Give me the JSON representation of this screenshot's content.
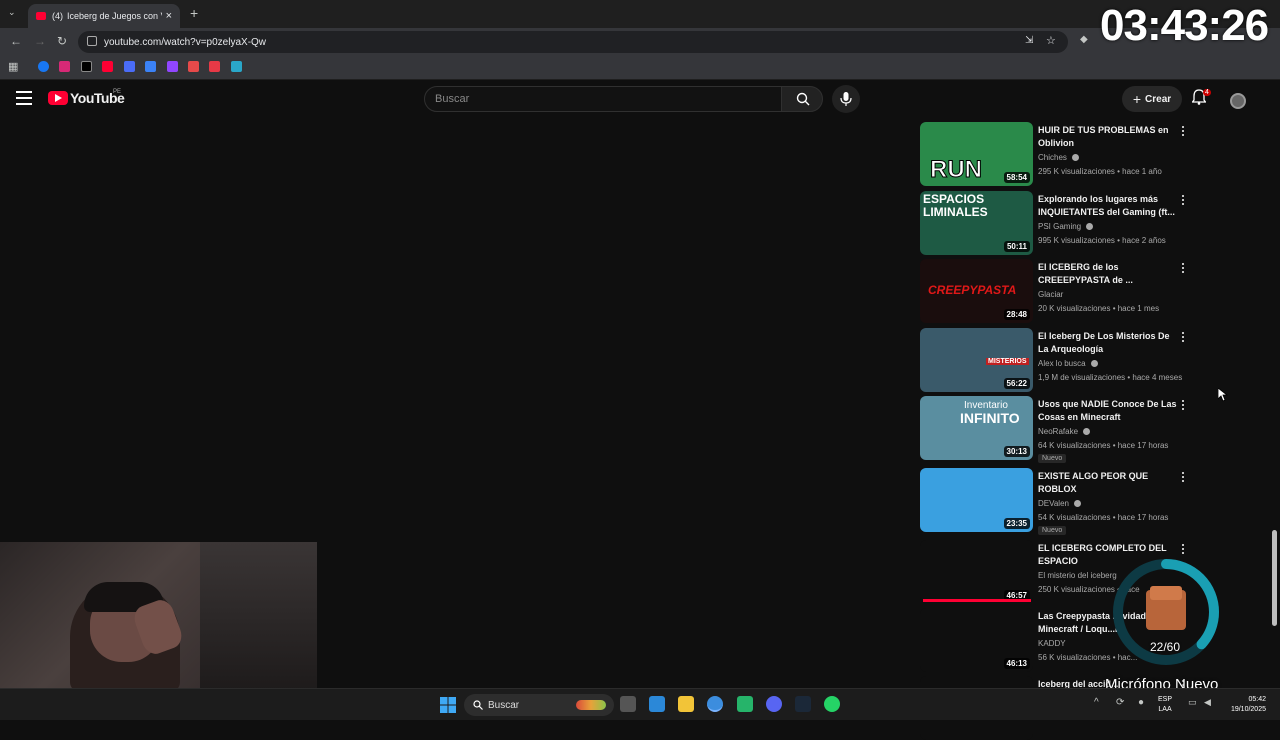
{
  "browser": {
    "tab_title": "Iceberg de Juegos con V",
    "tab_count_badge": "(4)",
    "url": "youtube.com/watch?v=p0zelyaX-Qw"
  },
  "overlay": {
    "timer": "03:43:26",
    "mic_count": "22/60",
    "mic_label": "Micrófono Nuevo"
  },
  "youtube": {
    "logo_text": "YouTube",
    "country": "PE",
    "search_placeholder": "Buscar",
    "create_label": "Crear",
    "notif_count": "4"
  },
  "videos": [
    {
      "title": "HUIR DE TUS PROBLEMAS en Oblivion",
      "channel": "Chiches",
      "verified": true,
      "meta": "295 K visualizaciones • hace 1 año",
      "duration": "58:54",
      "badge": "",
      "thumb_color": "#2a8a4a"
    },
    {
      "title": "Explorando los lugares más INQUIETANTES del Gaming (ft...",
      "channel": "PSI Gaming",
      "verified": true,
      "meta": "995 K visualizaciones • hace 2 años",
      "duration": "50:11",
      "badge": "",
      "thumb_color": "#1e5a44"
    },
    {
      "title": "El ICEBERG de los CREEEPYPASTA de ...",
      "channel": "Glaciar",
      "verified": false,
      "meta": "20 K visualizaciones • hace 1 mes",
      "duration": "28:48",
      "badge": "",
      "thumb_color": "#1a0d0d"
    },
    {
      "title": "El Iceberg De Los Misterios De La Arqueología",
      "channel": "Alex lo busca",
      "verified": true,
      "meta": "1,9 M de visualizaciones • hace 4 meses",
      "duration": "56:22",
      "badge": "",
      "thumb_color": "#3a5a6a"
    },
    {
      "title": "Usos que NADIE Conoce De Las Cosas en Minecraft",
      "channel": "NeoRafake",
      "verified": true,
      "meta": "64 K visualizaciones • hace 17 horas",
      "duration": "30:13",
      "badge": "Nuevo",
      "thumb_color": "#5a8ea0"
    },
    {
      "title": "EXISTE ALGO PEOR QUE ROBLOX",
      "channel": "DEValen",
      "verified": true,
      "meta": "54 K visualizaciones • hace 17 horas",
      "duration": "23:35",
      "badge": "Nuevo",
      "thumb_color": "#3aa0e0"
    },
    {
      "title": "EL ICEBERG COMPLETO DEL ESPACIO",
      "channel": "El misterio del iceberg",
      "verified": false,
      "meta": "250 K visualizaciones • hace",
      "duration": "46:57",
      "badge": "",
      "thumb_color": "#0f0f0f"
    },
    {
      "title": "Las Creepypasta ... vidad Minecraft / Loqu...io",
      "channel": "KADDY",
      "verified": false,
      "meta": "56 K visualizaciones • hac...",
      "duration": "46:13",
      "badge": "",
      "thumb_color": "#0f0f0f"
    },
    {
      "title": "Iceberg del accid...",
      "channel": "",
      "verified": false,
      "meta": "",
      "duration": "",
      "badge": "",
      "thumb_color": "#0f0f0f"
    }
  ],
  "thumb_text": {
    "v0": "RUN",
    "v1": "ESPACIOS LIMINALES",
    "v2": "CREEPYPASTA",
    "v3": "MISTERIOS",
    "v4_line1": "Inventario",
    "v4_line2": "INFINITO"
  },
  "taskbar": {
    "search_label": "Buscar",
    "lang_line1": "ESP",
    "lang_line2": "LAA",
    "time": "05:42",
    "date": "19/10/2025"
  },
  "colors": {
    "youtube_red": "#ff0033",
    "background": "#0f0f0f",
    "accent_ring": "#1a9fb3"
  }
}
